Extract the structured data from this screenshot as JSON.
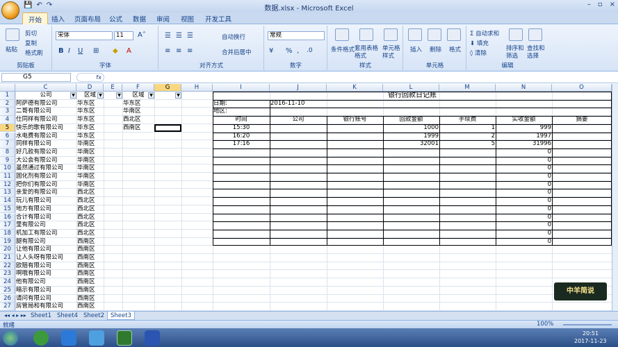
{
  "window": {
    "title": "数据.xlsx - Microsoft Excel",
    "min": "–",
    "max": "▫",
    "close": "×"
  },
  "tabs": [
    "开始",
    "插入",
    "页面布局",
    "公式",
    "数据",
    "审阅",
    "视图",
    "开发工具"
  ],
  "ribbon": {
    "clipboard": {
      "label": "剪贴板",
      "paste": "粘贴",
      "cut": "剪切",
      "copy": "复制",
      "painter": "格式刷"
    },
    "font": {
      "label": "字体",
      "name": "宋体",
      "size": "11",
      "bold": "B",
      "italic": "I",
      "underline": "U"
    },
    "align": {
      "label": "对齐方式",
      "wrap": "自动换行",
      "merge": "合并后居中"
    },
    "number": {
      "label": "数字",
      "format": "常规"
    },
    "styles": {
      "label": "样式",
      "cond": "条件格式",
      "table": "套用表格格式",
      "cellstyle": "单元格样式"
    },
    "cells": {
      "label": "单元格",
      "insert": "插入",
      "delete": "删除",
      "format": "格式"
    },
    "edit": {
      "label": "编辑",
      "autosum": "自动求和",
      "fill": "填充",
      "clear": "清除",
      "sort": "排序和筛选",
      "find": "查找和选择"
    }
  },
  "formula_bar": {
    "namebox": "G5",
    "fx": "fx",
    "content": ""
  },
  "columns": [
    "C",
    "D",
    "E",
    "F",
    "G",
    "H",
    "I",
    "J",
    "K",
    "L",
    "M",
    "N",
    "O"
  ],
  "rows": [
    "1",
    "2",
    "3",
    "4",
    "5",
    "6",
    "7",
    "8",
    "9",
    "10",
    "11",
    "12",
    "13",
    "14",
    "15",
    "16",
    "17",
    "18",
    "19",
    "20",
    "21",
    "22",
    "23",
    "24",
    "25",
    "26",
    "27"
  ],
  "col_c": [
    "公司",
    "阿萨德有限公司",
    "二哥有限公司",
    "仕同样有限公司",
    "快乐的歌有限公司",
    "水电费有限公司",
    "同样有限公司",
    "好几款有限公司",
    "大公会有限公司",
    "虽然通过有限公司",
    "固化剂有限公司",
    "把你们有限公司",
    "亲爱的有限公司",
    "玩儿有限公司",
    "地方有限公司",
    "合计有限公司",
    "里有限公司",
    "机加工有限公司",
    "腿有限公司",
    "让他有限公司",
    "让人头呀有限公司",
    "欧赔有限公司",
    "啊哦有限公司",
    "他有限公司",
    "暗示有限公司",
    "请问有限公司",
    "房管局和有限公司"
  ],
  "col_d": [
    "区域",
    "华东区",
    "华东区",
    "华东区",
    "华东区",
    "华东区",
    "华南区",
    "华南区",
    "华南区",
    "华南区",
    "华南区",
    "华南区",
    "西北区",
    "西北区",
    "西北区",
    "西北区",
    "西北区",
    "西北区",
    "西南区",
    "西南区",
    "西南区",
    "西南区",
    "西南区",
    "西南区",
    "西南区",
    "西南区",
    "西南区"
  ],
  "col_f": [
    "区域",
    "华东区",
    "华南区",
    "西北区",
    "西南区"
  ],
  "journal": {
    "title": "银行回款日记账",
    "date_label": "日期:",
    "date_value": "2016-11-10",
    "region_label": "地区:",
    "headers": [
      "时间",
      "公司",
      "银行账号",
      "回款金额",
      "手续费",
      "实收金额",
      "摘要"
    ],
    "entries": [
      {
        "time": "15:30",
        "amount": "1000",
        "fee": "1",
        "net": "999"
      },
      {
        "time": "16:20",
        "amount": "1999",
        "fee": "2",
        "net": "1997"
      },
      {
        "time": "17:16",
        "amount": "32001",
        "fee": "5",
        "net": "31996"
      }
    ],
    "zeros": [
      "0",
      "0",
      "0",
      "0",
      "0",
      "0",
      "0",
      "0",
      "0",
      "0",
      "0",
      "0"
    ]
  },
  "sheets": [
    "Sheet1",
    "Sheet4",
    "Sheet2",
    "Sheet3"
  ],
  "active_sheet": "Sheet3",
  "status": {
    "ready": "就绪",
    "zoom": "100%"
  },
  "taskbar": {
    "time": "20:51",
    "date": "2017-11-23"
  },
  "watermark": "中羊简说"
}
